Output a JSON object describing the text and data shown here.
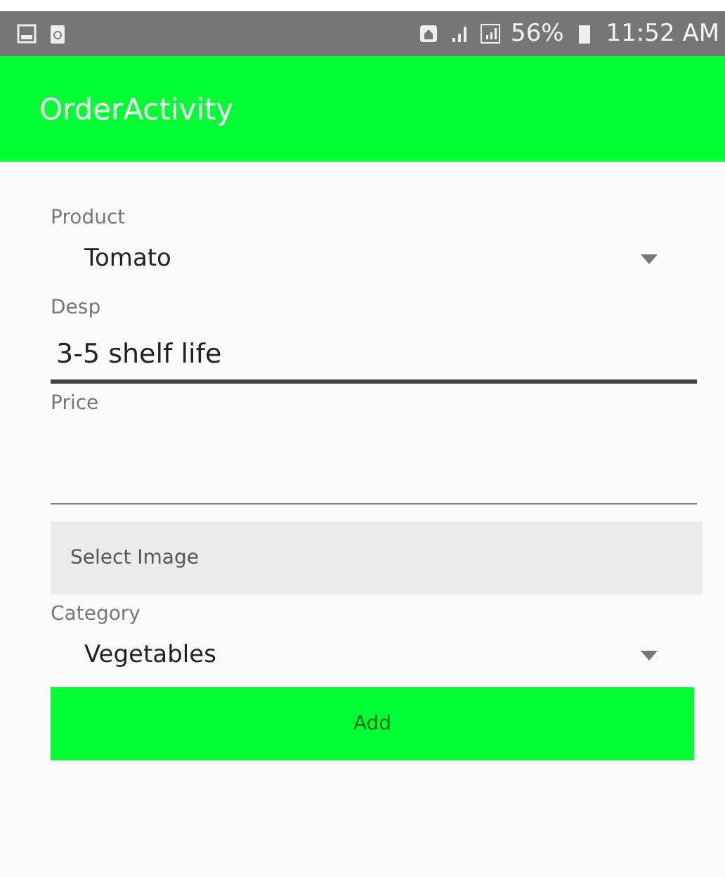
{
  "status_bar": {
    "battery": "56%",
    "time": "11:52 AM"
  },
  "app_bar": {
    "title": "OrderActivity"
  },
  "form": [
    {
      "kind": "spinner",
      "label": "Product",
      "value": "Tomato"
    },
    {
      "kind": "text",
      "label": "Desp",
      "value": "3-5 shelf life",
      "focused": true
    },
    {
      "kind": "text",
      "label": "Price",
      "focused": false
    },
    {
      "kind": "button",
      "label": "Select Image"
    },
    {
      "kind": "spinner",
      "label": "Category",
      "value": "Vegetables"
    },
    {
      "kind": "primary",
      "label": "Add"
    }
  ]
}
